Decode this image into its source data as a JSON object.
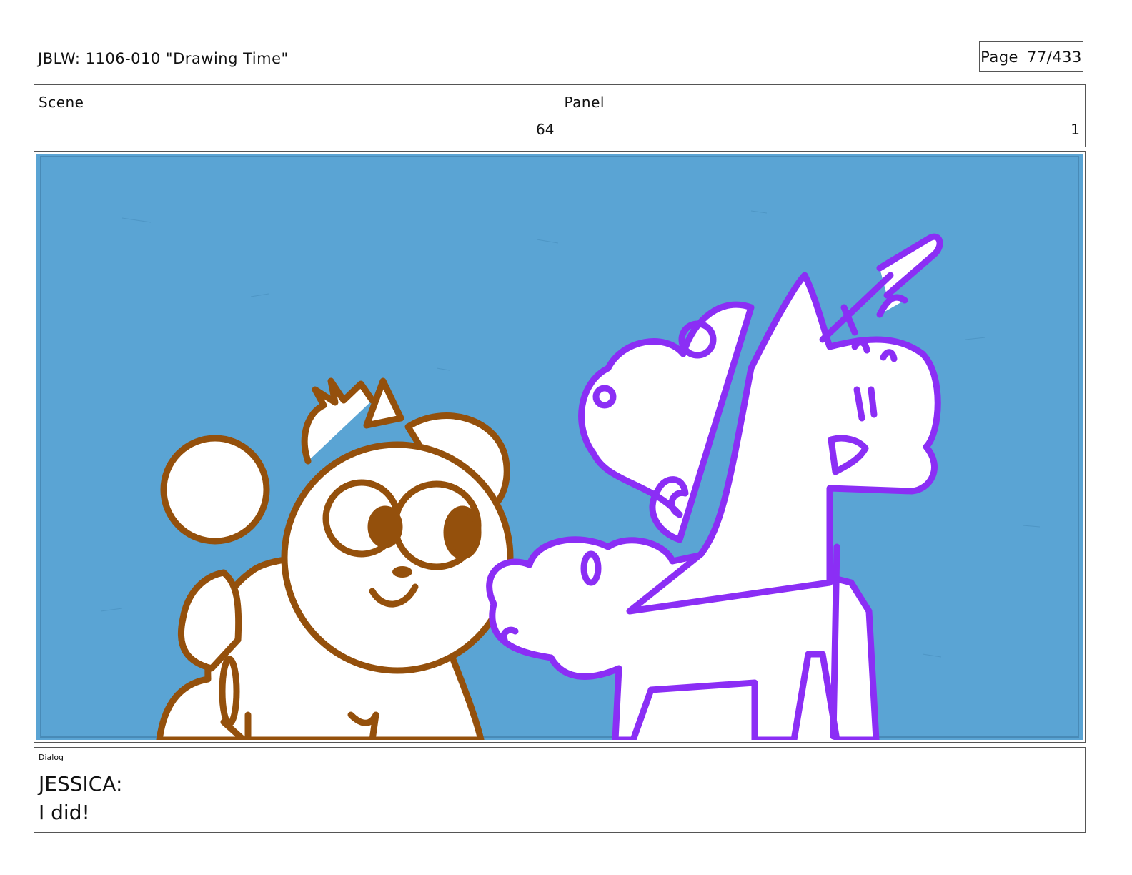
{
  "header": {
    "title": "JBLW: 1106-010 \"Drawing Time\"",
    "page_label": "Page",
    "page_number": "77/433"
  },
  "info": {
    "scene_label": "Scene",
    "scene_value": "64",
    "panel_label": "Panel",
    "panel_value": "1"
  },
  "panel": {
    "background_color": "#5aa4d4",
    "bear_color": "#94500c",
    "unicorn_color": "#8b2ef5"
  },
  "dialog": {
    "label": "Dialog",
    "speaker": "JESSICA:",
    "line": "I did!"
  }
}
